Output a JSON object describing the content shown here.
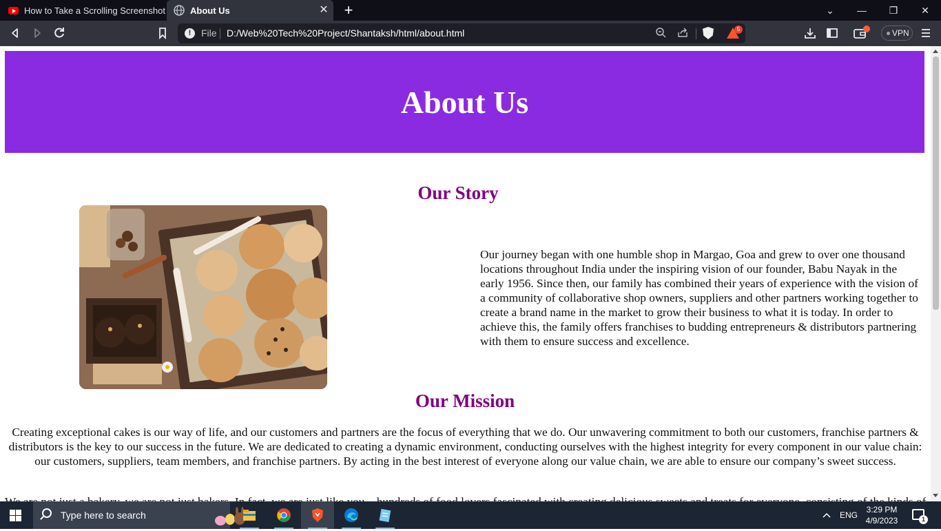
{
  "browser": {
    "tabs": [
      {
        "label": "How to Take a Scrolling Screenshot in",
        "icon": "youtube-icon",
        "active": false
      },
      {
        "label": "About Us",
        "icon": "globe-icon",
        "active": true
      }
    ],
    "new_tab_label": "+",
    "close_tab_glyph": "✕",
    "window_controls": {
      "dropdown": "⌄",
      "minimize": "—",
      "restore": "❐",
      "close": "✕"
    },
    "address_bar": {
      "scheme_label": "File",
      "url": "D:/Web%20Tech%20Project/Shantaksh/html/about.html"
    },
    "rewards_count": "5",
    "vpn_label": "VPN"
  },
  "page": {
    "hero_title": "About Us",
    "story": {
      "heading": "Our Story",
      "body": "Our journey began with one humble shop in Margao, Goa and grew to over one thousand locations throughout India under the inspiring vision of our founder, Babu Nayak in the early 1956. Since then, our family has combined their years of experience with the vision of a community of collaborative shop owners, suppliers and other partners working together to create a brand name in the market to grow their business to what it is today. In order to achieve this, the family offers franchises to budding entrepreneurs & distributors partnering with them to ensure success and excellence."
    },
    "mission": {
      "heading": "Our Mission",
      "body": "Creating exceptional cakes is our way of life, and our customers and partners are the focus of everything that we do. Our unwavering commitment to both our customers, franchise partners & distributors is the key to our success in the future. We are dedicated to creating a dynamic environment, conducting ourselves with the highest integrity for every component in our value chain: our customers, suppliers, team members, and franchise partners. By acting in the best interest of everyone along our value chain, we are able to ensure our company’s sweet success."
    },
    "next_paragraph_partial": "We are not just a bakery, we are not just bakers. In fact, we are just like you... hundreds of food lovers fascinated with creating delicious sweets and treats for everyone, consisting of the kinds of"
  },
  "taskbar": {
    "search_placeholder": "Type here to search",
    "language": "ENG",
    "time": "3:29 PM",
    "date": "4/9/2023",
    "notification_count": "1",
    "apps": [
      "file-explorer-icon",
      "chrome-icon",
      "brave-icon",
      "edge-icon",
      "notepad-icon"
    ]
  },
  "colors": {
    "hero_bg": "#8a2be2",
    "heading_purple": "#800080",
    "taskbar_bg": "#1c2533",
    "browser_toolbar": "#32343d"
  }
}
